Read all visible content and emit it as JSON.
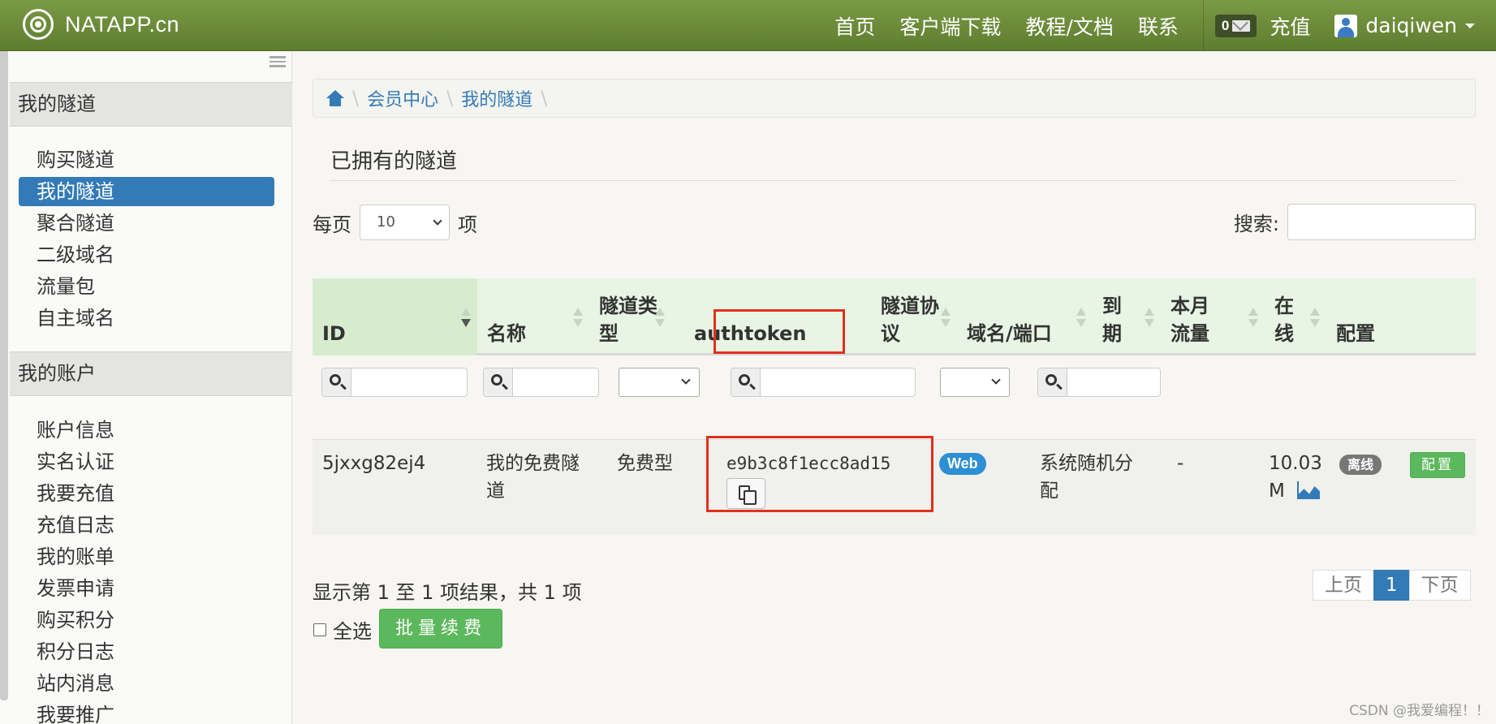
{
  "navbar": {
    "brand": "NATAPP.cn",
    "links": [
      "首页",
      "客户端下载",
      "教程/文档",
      "联系"
    ],
    "mail_count": "0",
    "recharge": "充值",
    "username": "daiqiwen"
  },
  "sidebar": {
    "group1": "我的隧道",
    "tunnel_items": [
      "购买隧道",
      "我的隧道",
      "聚合隧道",
      "二级域名",
      "流量包",
      "自主域名"
    ],
    "group2": "我的账户",
    "account_items": [
      "账户信息",
      "实名认证",
      "我要充值",
      "充值日志",
      "我的账单",
      "发票申请",
      "购买积分",
      "积分日志",
      "站内消息",
      "我要推广"
    ]
  },
  "breadcrumb": [
    "会员中心",
    "我的隧道"
  ],
  "page_title": "已拥有的隧道",
  "length": {
    "prefix": "每页",
    "value": "10",
    "suffix": "项"
  },
  "search": {
    "label": "搜索:"
  },
  "table": {
    "headers": [
      "ID",
      "名称",
      "隧道类型",
      "authtoken",
      "隧道协议",
      "域名/端口",
      "到期",
      "本月流量",
      "在线",
      "配置"
    ],
    "row": {
      "id": "5jxxg82ej4",
      "name": "我的免费隧道",
      "type": "免费型",
      "authtoken": "e9b3c8f1ecc8ad15",
      "protocol": "Web",
      "domain": "系统随机分配",
      "expire": "-",
      "traffic": "10.03 M",
      "online": "离线",
      "config": "配置"
    }
  },
  "info_text": "显示第 1 至 1 项结果，共 1 项",
  "pagination": {
    "prev": "上页",
    "current": "1",
    "next": "下页"
  },
  "select_all": "全选",
  "batch_renew": "批量续费",
  "watermark": "CSDN @我爱编程！！"
}
